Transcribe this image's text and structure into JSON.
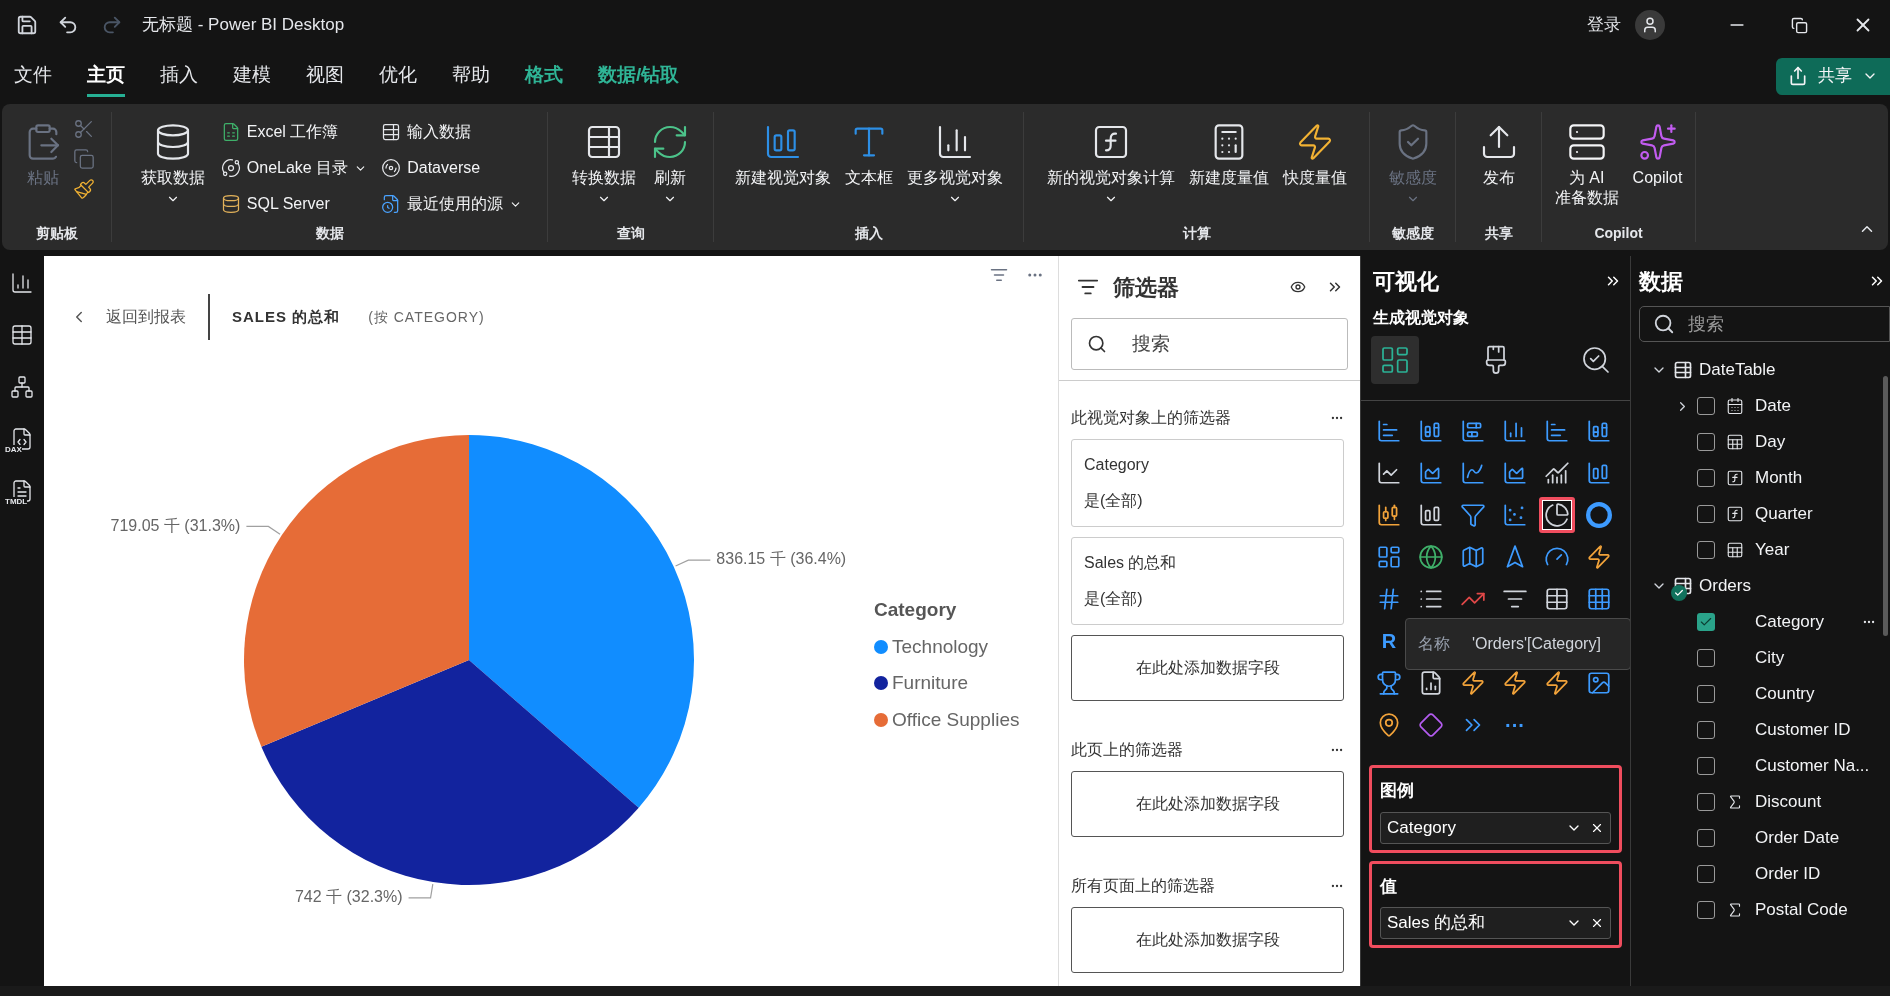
{
  "window": {
    "title": "无标题 - Power BI Desktop",
    "sign_in": "登录"
  },
  "menu": {
    "tabs": [
      {
        "label": "文件",
        "selected": false,
        "kind": "normal"
      },
      {
        "label": "主页",
        "selected": true,
        "kind": "normal"
      },
      {
        "label": "插入",
        "selected": false,
        "kind": "normal"
      },
      {
        "label": "建模",
        "selected": false,
        "kind": "normal"
      },
      {
        "label": "视图",
        "selected": false,
        "kind": "normal"
      },
      {
        "label": "优化",
        "selected": false,
        "kind": "normal"
      },
      {
        "label": "帮助",
        "selected": false,
        "kind": "normal"
      },
      {
        "label": "格式",
        "selected": false,
        "kind": "contextual"
      },
      {
        "label": "数据/钻取",
        "selected": false,
        "kind": "contextual"
      }
    ],
    "share": "共享"
  },
  "ribbon": {
    "groups": [
      {
        "label": "剪贴板",
        "large": [
          {
            "label": "粘贴",
            "disabled": true,
            "dropdown": false
          }
        ],
        "tools": [
          {
            "disabled": true
          },
          {
            "disabled": true
          },
          {
            "disabled": false
          }
        ]
      },
      {
        "label": "数据",
        "large": [
          {
            "label": "获取数据",
            "disabled": false,
            "dropdown": true
          }
        ],
        "small": [
          {
            "label": "Excel 工作簿",
            "dropdown": false
          },
          {
            "label": "OneLake 目录",
            "dropdown": true
          },
          {
            "label": "SQL Server",
            "dropdown": false
          },
          {
            "label": "输入数据",
            "dropdown": false
          },
          {
            "label": "Dataverse",
            "dropdown": false
          },
          {
            "label": "最近使用的源",
            "dropdown": true
          }
        ]
      },
      {
        "label": "查询",
        "large": [
          {
            "label": "转换数据",
            "disabled": false,
            "dropdown": true
          },
          {
            "label": "刷新",
            "disabled": false,
            "dropdown": true
          }
        ]
      },
      {
        "label": "插入",
        "large": [
          {
            "label": "新建视觉对象",
            "disabled": false,
            "dropdown": false
          },
          {
            "label": "文本框",
            "disabled": false,
            "dropdown": false
          },
          {
            "label": "更多视觉对象",
            "disabled": false,
            "dropdown": true
          }
        ]
      },
      {
        "label": "计算",
        "large": [
          {
            "label": "新的视觉对象计算",
            "disabled": false,
            "dropdown": true
          },
          {
            "label": "新建度量值",
            "disabled": false,
            "dropdown": false
          },
          {
            "label": "快度量值",
            "disabled": false,
            "dropdown": false
          }
        ]
      },
      {
        "label": "敏感度",
        "large": [
          {
            "label": "敏感度",
            "disabled": true,
            "dropdown": true
          }
        ]
      },
      {
        "label": "共享",
        "large": [
          {
            "label": "发布",
            "disabled": false,
            "dropdown": false
          }
        ]
      },
      {
        "label": "Copilot",
        "large": [
          {
            "label": "为 AI\n准备数据",
            "disabled": false,
            "dropdown": false
          },
          {
            "label": "Copilot",
            "disabled": false,
            "dropdown": false
          }
        ]
      }
    ]
  },
  "rail": {
    "items": [
      {
        "kind": "report"
      },
      {
        "kind": "table"
      },
      {
        "kind": "model"
      },
      {
        "kind": "dax",
        "text": "DAX"
      },
      {
        "kind": "tmdl",
        "text": "TMDL"
      }
    ]
  },
  "visual": {
    "back": "返回到报表",
    "title": "SALES 的总和",
    "subtitle": "(按 CATEGORY)",
    "chart_data": {
      "type": "pie",
      "categories": [
        "Technology",
        "Furniture",
        "Office Supplies"
      ],
      "values": [
        836.15,
        742,
        719.05
      ],
      "value_labels": [
        "836.15 千 (36.4%)",
        "742 千 (32.3%)",
        "719.05 千 (31.3%)"
      ]
    },
    "legend": {
      "title": "Category",
      "items": [
        {
          "color": "#118dff"
        },
        {
          "color": "#12239e"
        },
        {
          "color": "#e66c37"
        }
      ]
    }
  },
  "filters": {
    "title": "筛选器",
    "search": {
      "placeholder": "搜索"
    },
    "sections": [
      {
        "title": "此视觉对象上的筛选器",
        "cards": [
          {
            "field": "Category",
            "value": "是(全部)"
          },
          {
            "field": "Sales 的总和",
            "value": "是(全部)"
          }
        ],
        "drop": "在此处添加数据字段"
      },
      {
        "title": "此页上的筛选器",
        "drop": "在此处添加数据字段"
      },
      {
        "title": "所有页面上的筛选器",
        "drop": "在此处添加数据字段"
      }
    ]
  },
  "visualizations": {
    "title": "可视化",
    "subtitle": "生成视觉对象",
    "tabs": [
      {
        "selected": true
      },
      {
        "selected": false
      },
      {
        "selected": false
      }
    ],
    "gallery": [
      [
        {
          "kind": "icon",
          "selected": false,
          "annotated": false
        },
        {
          "kind": "icon",
          "selected": false,
          "annotated": false
        },
        {
          "kind": "icon",
          "selected": false,
          "annotated": false
        },
        {
          "kind": "icon",
          "selected": false,
          "annotated": false
        },
        {
          "kind": "icon",
          "selected": false,
          "annotated": false
        },
        {
          "kind": "icon",
          "selected": false,
          "annotated": false
        }
      ],
      [
        {
          "kind": "icon",
          "selected": false,
          "annotated": false
        },
        {
          "kind": "icon",
          "selected": false,
          "annotated": false
        },
        {
          "kind": "icon",
          "selected": false,
          "annotated": false
        },
        {
          "kind": "icon",
          "selected": false,
          "annotated": false
        },
        {
          "kind": "icon",
          "selected": false,
          "annotated": false
        },
        {
          "kind": "icon",
          "selected": false,
          "annotated": false
        }
      ],
      [
        {
          "kind": "icon",
          "selected": false,
          "annotated": false
        },
        {
          "kind": "icon",
          "selected": false,
          "annotated": false
        },
        {
          "kind": "icon",
          "selected": false,
          "annotated": false
        },
        {
          "kind": "icon",
          "selected": false,
          "annotated": false
        },
        {
          "kind": "icon",
          "selected": true,
          "annotated": true
        },
        {
          "kind": "icon",
          "selected": false,
          "annotated": false
        }
      ],
      [
        {
          "kind": "icon",
          "selected": false,
          "annotated": false
        },
        {
          "kind": "icon",
          "selected": false,
          "annotated": false
        },
        {
          "kind": "icon",
          "selected": false,
          "annotated": false
        },
        {
          "kind": "icon",
          "selected": false,
          "annotated": false
        },
        {
          "kind": "icon",
          "selected": false,
          "annotated": false
        },
        {
          "kind": "icon",
          "selected": false,
          "annotated": false
        }
      ],
      [
        {
          "kind": "icon",
          "selected": false,
          "annotated": false
        },
        {
          "kind": "icon",
          "selected": false,
          "annotated": false
        },
        {
          "kind": "icon",
          "selected": false,
          "annotated": false
        },
        {
          "kind": "icon",
          "selected": false,
          "annotated": false
        },
        {
          "kind": "icon",
          "selected": false,
          "annotated": false
        },
        {
          "kind": "icon",
          "selected": false,
          "annotated": false
        }
      ],
      [
        {
          "kind": "text",
          "text": "R",
          "selected": false,
          "annotated": false
        }
      ],
      [
        {
          "kind": "icon",
          "selected": false,
          "annotated": false
        },
        {
          "kind": "icon",
          "selected": false,
          "annotated": false
        },
        {
          "kind": "icon",
          "selected": false,
          "annotated": false
        },
        {
          "kind": "icon",
          "selected": false,
          "annotated": false
        },
        {
          "kind": "icon",
          "selected": false,
          "annotated": false
        },
        {
          "kind": "icon",
          "selected": false,
          "annotated": false
        }
      ],
      [
        {
          "kind": "icon",
          "selected": false,
          "annotated": false
        },
        {
          "kind": "icon",
          "selected": false,
          "annotated": false
        },
        {
          "kind": "icon",
          "selected": false,
          "annotated": false
        },
        {
          "kind": "text",
          "text": "···",
          "selected": false,
          "annotated": false
        }
      ]
    ],
    "tooltip": {
      "label": "名称",
      "value": "'Orders'[Category]"
    },
    "wells": [
      {
        "label": "图例",
        "field": "Category",
        "annotated": true
      },
      {
        "label": "值",
        "field": "Sales 的总和",
        "annotated": true
      }
    ]
  },
  "data_pane": {
    "title": "数据",
    "search": {
      "placeholder": "搜索"
    },
    "tables": [
      {
        "name": "DateTable",
        "expanded": true,
        "in_use": false,
        "fields": [
          {
            "name": "Date",
            "kind": "hierarchy",
            "expanded": false,
            "checked": false,
            "hovered": false
          },
          {
            "name": "Day",
            "kind": "calc",
            "checked": false,
            "hovered": false
          },
          {
            "name": "Month",
            "kind": "fx",
            "checked": false,
            "hovered": false
          },
          {
            "name": "Quarter",
            "kind": "fx",
            "checked": false,
            "hovered": false
          },
          {
            "name": "Year",
            "kind": "calc",
            "checked": false,
            "hovered": false
          }
        ]
      },
      {
        "name": "Orders",
        "expanded": true,
        "in_use": true,
        "fields": [
          {
            "name": "Category",
            "kind": "plain",
            "checked": true,
            "hovered": true
          },
          {
            "name": "City",
            "kind": "plain",
            "checked": false,
            "hovered": false
          },
          {
            "name": "Country",
            "kind": "plain",
            "checked": false,
            "hovered": false
          },
          {
            "name": "Customer ID",
            "kind": "plain",
            "checked": false,
            "hovered": false
          },
          {
            "name": "Customer Na...",
            "kind": "plain",
            "checked": false,
            "hovered": false
          },
          {
            "name": "Discount",
            "kind": "sum",
            "checked": false,
            "hovered": false
          },
          {
            "name": "Order Date",
            "kind": "plain",
            "checked": false,
            "hovered": false
          },
          {
            "name": "Order ID",
            "kind": "plain",
            "checked": false,
            "hovered": false
          },
          {
            "name": "Postal Code",
            "kind": "sum",
            "checked": false,
            "hovered": false
          }
        ]
      }
    ]
  }
}
